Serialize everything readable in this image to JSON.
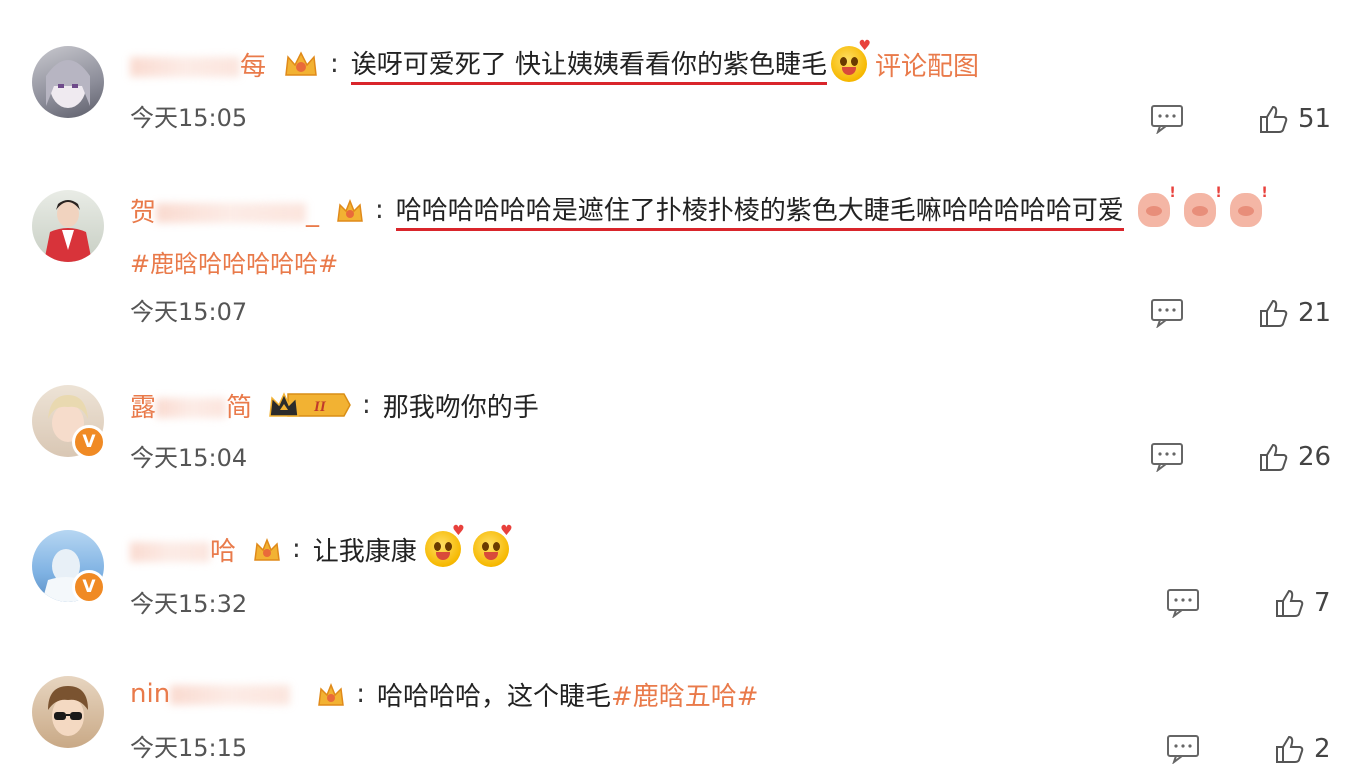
{
  "comments": [
    {
      "username_visible": "每",
      "text_underlined": "诶呀可爱死了 快让姨姨看看你的紫色睫毛",
      "emoji": "smile-emoji",
      "link": "评论配图",
      "time": "今天15:05",
      "likes": "51"
    },
    {
      "username_visible": "贺",
      "username_tail": "_",
      "text_underlined": "哈哈哈哈哈哈是遮住了扑棱扑棱的紫色大睫毛嘛哈哈哈哈哈可爱",
      "hashtag": "#鹿晗哈哈哈哈哈#",
      "time": "今天15:07",
      "likes": "21"
    },
    {
      "username_visible": "露",
      "username_tail": "简",
      "badge_text": "II",
      "text": "那我吻你的手",
      "verified": "V",
      "time": "今天15:04",
      "likes": "26"
    },
    {
      "username_tail": "哈",
      "text": "让我康康",
      "verified": "V",
      "time": "今天15:32",
      "likes": "7"
    },
    {
      "username_visible": "nin",
      "text": "哈哈哈哈，这个睫毛",
      "hashtag": "#鹿晗五哈#",
      "time": "今天15:15",
      "likes": "2"
    }
  ],
  "colors": {
    "accent": "#e97a4a",
    "underline": "#d9252b",
    "verified": "#f08a24"
  }
}
